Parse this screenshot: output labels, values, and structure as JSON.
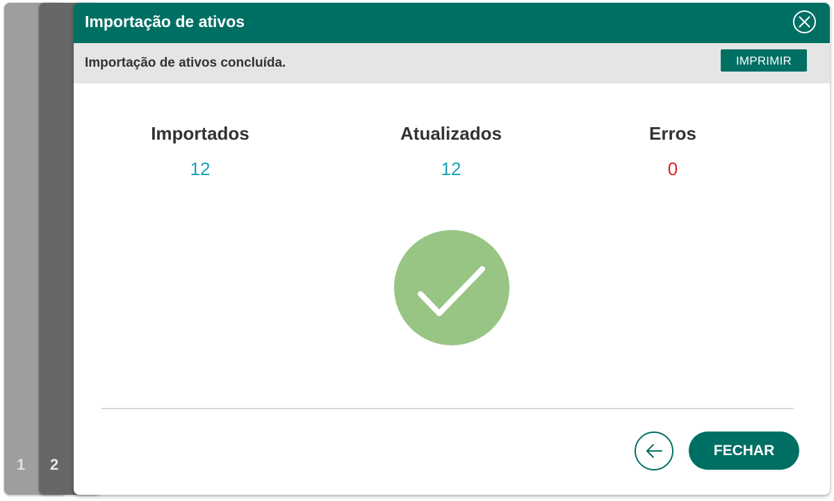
{
  "steps": [
    {
      "number": "1"
    },
    {
      "number": "2"
    }
  ],
  "dialog": {
    "title": "Importação de ativos",
    "close_icon": "close-circle-icon",
    "status_message": "Importação de ativos concluída.",
    "print_label": "IMPRIMIR"
  },
  "stats": {
    "importados": {
      "label": "Importados",
      "value": "12"
    },
    "atualizados": {
      "label": "Atualizados",
      "value": "12"
    },
    "erros": {
      "label": "Erros",
      "value": "0"
    }
  },
  "result_icon": "checkmark-success-icon",
  "footer": {
    "back_icon": "arrow-left-icon",
    "close_label": "FECHAR"
  },
  "colors": {
    "primary": "#006f63",
    "status_bar": "#e5e5e5",
    "success": "#98c584",
    "value": "#1aa3b8",
    "error": "#e02020"
  }
}
